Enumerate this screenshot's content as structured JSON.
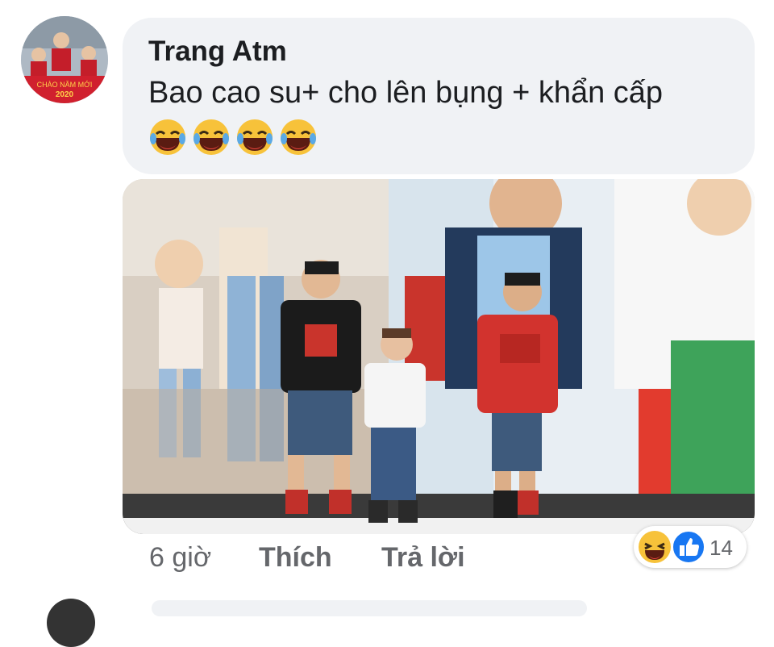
{
  "comment": {
    "author": "Trang Atm",
    "text": "Bao cao su+ cho lên bụng + khẩn cấp",
    "emojis": [
      "haha-emoji",
      "haha-emoji",
      "haha-emoji",
      "haha-emoji"
    ],
    "avatar_banner": "CHÀO NĂM MỚI 2020"
  },
  "photo": {
    "icon": "photo-attachment"
  },
  "actions": {
    "time": "6 giờ",
    "like": "Thích",
    "reply": "Trả lời"
  },
  "reactions": {
    "icons": [
      "haha-icon",
      "like-icon"
    ],
    "count": "14"
  },
  "colors": {
    "bubble": "#f0f2f5",
    "like_blue": "#1877f2",
    "text_primary": "#1c1e21",
    "text_secondary": "#65676b"
  }
}
